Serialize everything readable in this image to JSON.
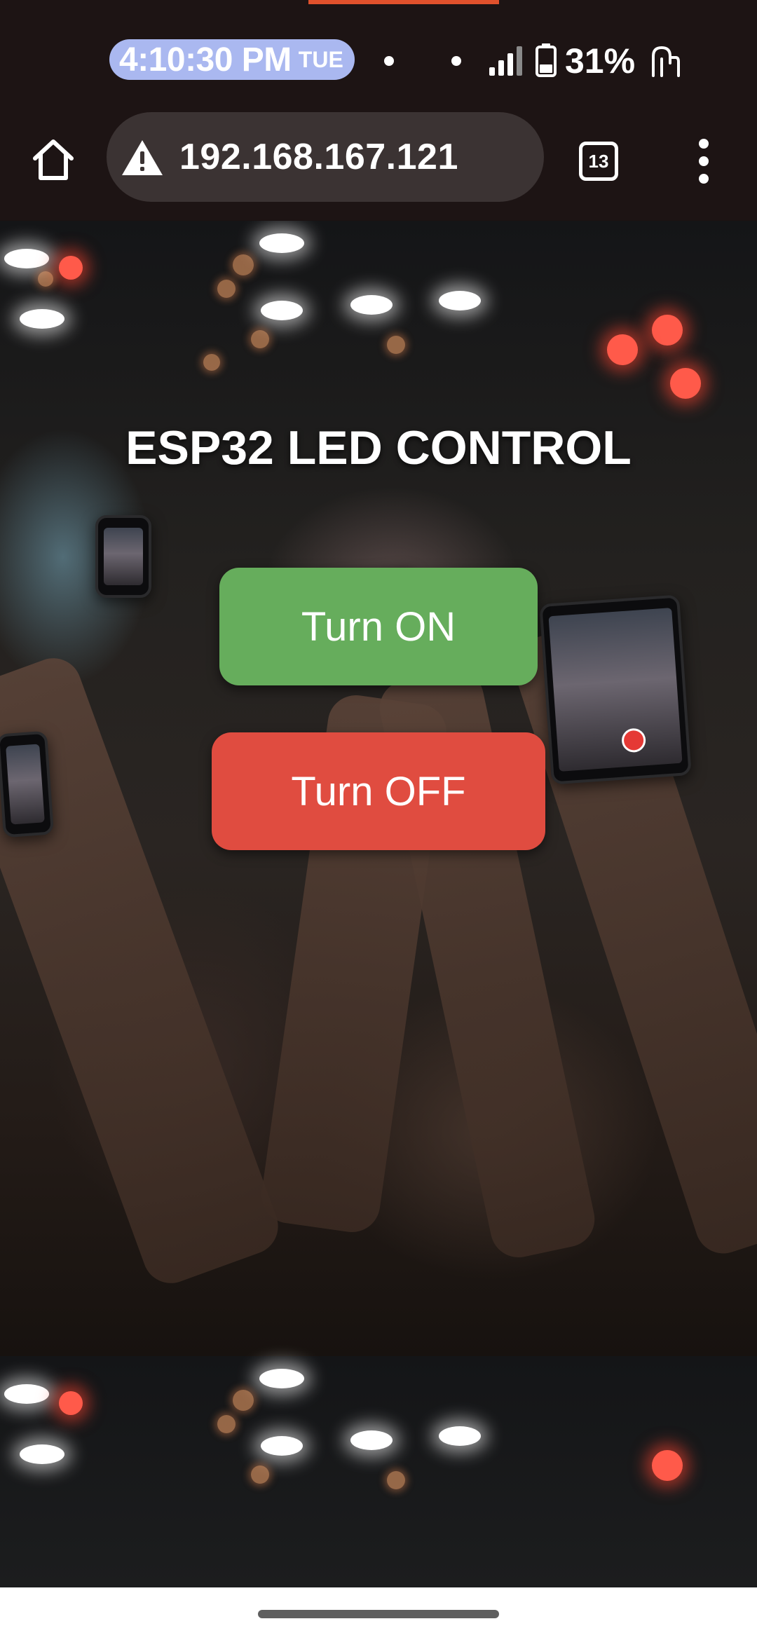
{
  "status_bar": {
    "time": "4:10:30 PM",
    "day": "TUE",
    "battery_percent": "31%",
    "icons": [
      "dot-icon",
      "dot-icon",
      "signal-icon",
      "battery-icon",
      "hand-icon"
    ]
  },
  "browser": {
    "url": "192.168.167.121",
    "security_icon": "warning-icon",
    "tab_count": "13",
    "icons": [
      "home-icon",
      "tabs-icon",
      "more-vert-icon"
    ]
  },
  "page": {
    "title": "ESP32 LED CONTROL",
    "on_button_label": "Turn ON",
    "off_button_label": "Turn OFF"
  },
  "colors": {
    "on_button": "#66ad5c",
    "off_button": "#e04c40",
    "time_pill": "#aab8f0",
    "toolbar": "#1d1414",
    "url_bar": "#3b3333"
  }
}
